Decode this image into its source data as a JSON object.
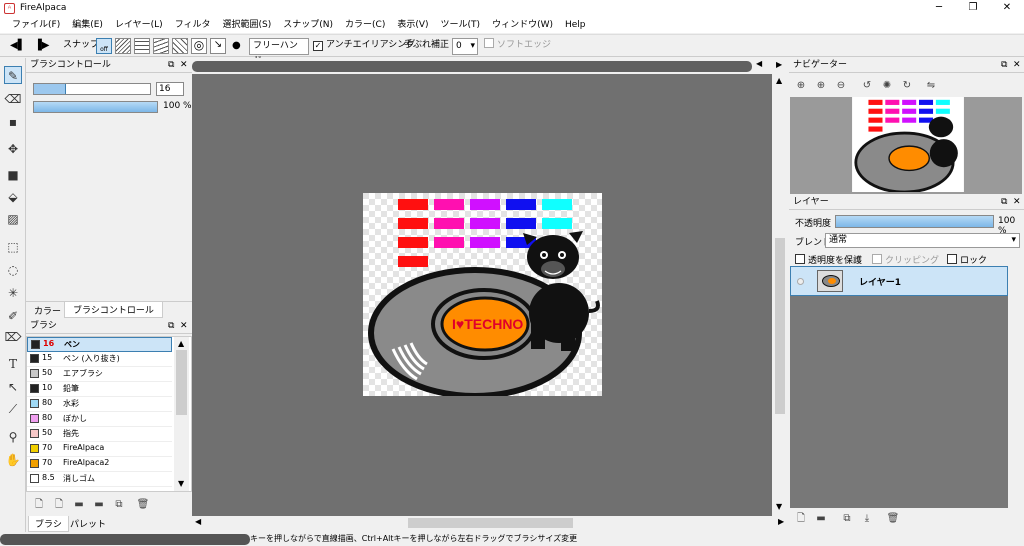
{
  "window": {
    "app_name": "FireAlpaca",
    "minimize": "─",
    "restore": "❐",
    "close": "✕"
  },
  "menu": [
    "ファイル(F)",
    "編集(E)",
    "レイヤー(L)",
    "フィルタ",
    "選択範囲(S)",
    "スナップ(N)",
    "カラー(C)",
    "表示(V)",
    "ツール(T)",
    "ウィンドウ(W)",
    "Help"
  ],
  "toolbar": {
    "snap_label": "スナップ",
    "snap_off": "off",
    "mode": "フリーハンド",
    "antialias": "アンチエイリアシング",
    "stabilizer_label": "手ぶれ補正",
    "stabilizer_value": "0",
    "soft_edge": "ソフトエッジ"
  },
  "brush_control": {
    "title": "ブラシコントロール",
    "size_value": "16",
    "opacity_label": "100 %",
    "size_fraction": 0.28,
    "opacity_fraction": 1.0
  },
  "left_tabs": {
    "color": "カラー",
    "brush_control": "ブラシコントロール"
  },
  "brush_panel": {
    "title": "ブラシ",
    "items": [
      {
        "size": "16",
        "name": "ペン",
        "color": "#222222",
        "selected": true
      },
      {
        "size": "15",
        "name": "ペン (入り抜き)",
        "color": "#222222"
      },
      {
        "size": "50",
        "name": "エアブラシ",
        "color": "#c8c8c8"
      },
      {
        "size": "10",
        "name": "鉛筆",
        "color": "#222222"
      },
      {
        "size": "80",
        "name": "水彩",
        "color": "#9fd9f5"
      },
      {
        "size": "80",
        "name": "ぼかし",
        "color": "#f0a0f0"
      },
      {
        "size": "50",
        "name": "指先",
        "color": "#f7c8c8"
      },
      {
        "size": "70",
        "name": "FireAlpaca",
        "color": "#f2d000"
      },
      {
        "size": "70",
        "name": "FireAlpaca2",
        "color": "#f2a000"
      },
      {
        "size": "8.5",
        "name": "消しゴム",
        "color": "#ffffff"
      }
    ],
    "tab_brush": "ブラシ",
    "tab_palette": "パレット"
  },
  "navigator": {
    "title": "ナビゲーター"
  },
  "layer_panel": {
    "title": "レイヤー",
    "opacity_label": "不透明度",
    "opacity_value": "100 %",
    "opacity_fraction": 1.0,
    "blend_label": "ブレンド",
    "blend_value": "通常",
    "protect_alpha": "透明度を保護",
    "clipping": "クリッピング",
    "lock": "ロック",
    "layers": [
      {
        "name": "レイヤー1"
      }
    ]
  },
  "artwork": {
    "logo_text": "I♥TECHNO"
  },
  "status": {
    "text": "キーを押しながらで直線描画、Ctrl+Altキーを押しながら左右ドラッグでブラシサイズ変更"
  },
  "colors": {
    "accent": "#cce4f7",
    "red": "#ff1010",
    "magenta": "#ff10b0",
    "purple": "#d010ff",
    "blue": "#1010f0",
    "cyan": "#10ffff",
    "orange": "#ff8c00"
  }
}
